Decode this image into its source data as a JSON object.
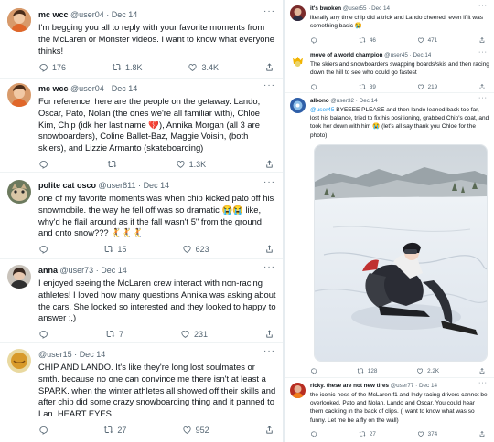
{
  "left": {
    "tweets": [
      {
        "name": "mc wcc",
        "handle": "@user04",
        "date": "Dec 14",
        "text": "I'm begging you all to reply with your favorite moments from the McLaren or Monster videos. I want to know what everyone thinks!",
        "replies": "176",
        "retweets": "1.8K",
        "likes": "3.4K"
      },
      {
        "name": "mc wcc",
        "handle": "@user04",
        "date": "Dec 14",
        "text": "For reference, here are the people on the getaway. Lando, Oscar, Pato, Nolan (the ones we're all familiar with), Chloe Kim, Chip (idk her last name 💔), Annika Morgan (all 3 are snowboarders), Coline Ballet-Baz, Maggie Voisin, (both skiers), and Lizzie Armanto (skateboarding)",
        "replies": "",
        "retweets": "",
        "likes": "1.3K"
      },
      {
        "name": "polite cat osco",
        "handle": "@user811",
        "date": "Dec 14",
        "text": "one of my favorite moments was when chip kicked pato off his snowmobile. the way he fell off was so dramatic 😭😭 like, why'd he flail around as if the fall wasn't 5\" from the ground and onto snow??? 🤾🤾🤾",
        "replies": "",
        "retweets": "15",
        "likes": "623"
      },
      {
        "name": "anna",
        "handle": "@user73",
        "date": "Dec 14",
        "text": "I enjoyed seeing the McLaren crew interact with non-racing athletes! I loved how many questions Annika was asking about the cars. She looked so interested and they looked to happy to answer :,)",
        "replies": "",
        "retweets": "7",
        "likes": "231"
      },
      {
        "name": "",
        "handle": "@user15",
        "date": "Dec 14",
        "text": "CHIP AND LANDO. It's like they're long lost soulmates or smth. because no one can convince me there isn't at least a SPARK. when the winter athletes all showed off their skills and after chip did some crazy snowboarding thing and it panned to Lan. HEART EYES",
        "replies": "",
        "retweets": "27",
        "likes": "952"
      }
    ]
  },
  "right": {
    "tweets": [
      {
        "name": "it's bwoken",
        "handle": "@user55",
        "date": "Dec 14",
        "text": "literally any time chip did a trick and Lando cheered. even if it was something basic 😭",
        "replies": "",
        "retweets": "46",
        "likes": "471"
      },
      {
        "name": "move of a world champion",
        "handle": "@user45",
        "date": "Dec 14",
        "text": "The skiers and snowboarders swapping boards/skis and then racing down the hill to see who could go fastest",
        "replies": "",
        "retweets": "39",
        "likes": "219"
      },
      {
        "name": "albono",
        "handle": "@user32",
        "date": "Dec 14",
        "mention": "@user45",
        "text": "BYEEEE PLEASE and then lando leaned back too far, lost his balance, tried to fix his positioning, grabbed Chip's coat, and took her down with him 😭 (let's all say thank you Chloe for the photo)",
        "replies": "",
        "retweets": "128",
        "likes": "2.2K"
      },
      {
        "name": "ricky. these are not new tires",
        "handle": "@user77",
        "date": "Dec 14",
        "text": "the iconic-ness of the McLaren f1 and Indy racing drivers cannot be overlooked. Pato and Nolan, Lando and Oscar. You could hear them cackling in the back of clips. (i want to know what was so funny. Let me be a fly on the wall)",
        "replies": "",
        "retweets": "27",
        "likes": "374"
      }
    ]
  },
  "colors": {
    "text": "#0f1419",
    "muted": "#536471",
    "link": "#1d9bf0",
    "border": "#eff3f4"
  },
  "icons": [
    "reply-icon",
    "retweet-icon",
    "like-icon",
    "share-icon",
    "more-icon"
  ]
}
